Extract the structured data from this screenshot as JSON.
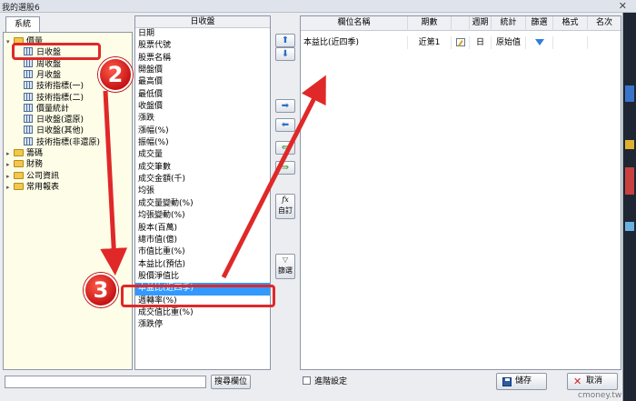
{
  "window": {
    "title": "我的選股6",
    "close_glyph": "✕"
  },
  "left": {
    "tab_label": "系統",
    "tree": [
      {
        "label": "價量",
        "level": 0,
        "type": "folder",
        "expanded": true
      },
      {
        "label": "日收盤",
        "level": 1,
        "type": "grid",
        "selected": true
      },
      {
        "label": "周收盤",
        "level": 1,
        "type": "grid"
      },
      {
        "label": "月收盤",
        "level": 1,
        "type": "grid"
      },
      {
        "label": "技術指標(一)",
        "level": 1,
        "type": "grid"
      },
      {
        "label": "技術指標(二)",
        "level": 1,
        "type": "grid"
      },
      {
        "label": "價量統計",
        "level": 1,
        "type": "grid"
      },
      {
        "label": "日收盤(還原)",
        "level": 1,
        "type": "grid"
      },
      {
        "label": "日收盤(其他)",
        "level": 1,
        "type": "grid"
      },
      {
        "label": "技術指標(非還原)",
        "level": 1,
        "type": "grid"
      },
      {
        "label": "籌碼",
        "level": 0,
        "type": "folder"
      },
      {
        "label": "財務",
        "level": 0,
        "type": "folder"
      },
      {
        "label": "公司資訊",
        "level": 0,
        "type": "folder"
      },
      {
        "label": "常用報表",
        "level": 0,
        "type": "folder"
      }
    ]
  },
  "middle": {
    "header": "日收盤",
    "items": [
      "日期",
      "股票代號",
      "股票名稱",
      "開盤價",
      "最高價",
      "最低價",
      "收盤價",
      "漲跌",
      "漲幅(%)",
      "振幅(%)",
      "成交量",
      "成交筆數",
      "成交金額(千)",
      "均張",
      "成交量變動(%)",
      "均張變動(%)",
      "股本(百萬)",
      "總市值(億)",
      "市值比重(%)",
      "本益比(預估)",
      "股價淨值比",
      "本益比(近四季)",
      "週轉率(%)",
      "成交值比重(%)",
      "漲跌停"
    ],
    "selected_index": 21
  },
  "buttons": {
    "move_up": "⬆",
    "move_down": "⬇",
    "add": "➡",
    "remove": "⬅",
    "add_all": "⇚",
    "remove_all": "⇛",
    "custom_glyph": "fx",
    "custom_label": "自訂",
    "filter_glyph": "▽",
    "filter_label": "篩選"
  },
  "table": {
    "columns": [
      "欄位名稱",
      "期數",
      "",
      "週期",
      "統計",
      "篩選",
      "格式",
      "名次"
    ],
    "rows": [
      {
        "name": "本益比(近四季)",
        "periods": "近第1",
        "cycle": "日",
        "stat": "原始值"
      }
    ]
  },
  "bottom": {
    "search_placeholder": "",
    "search_button": "搜尋欄位",
    "advanced_label": "進階設定",
    "save_label": "儲存",
    "cancel_label": "取消",
    "cancel_glyph": "✕"
  },
  "annotations": {
    "badge_2": "2",
    "badge_3": "3"
  },
  "watermark": "cmoney.tw",
  "colors": {
    "highlight": "#e02828",
    "selection": "#3399ff",
    "tree_bg": "#fefde8"
  }
}
